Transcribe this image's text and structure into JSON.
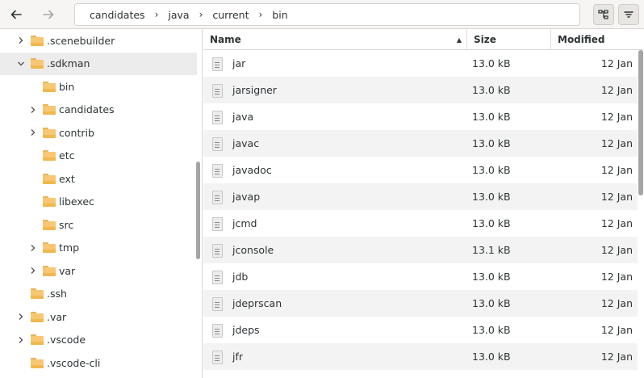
{
  "toolbar": {
    "back_icon": "back-arrow-icon",
    "forward_icon": "forward-arrow-icon",
    "breadcrumb": [
      "candidates",
      "java",
      "current",
      "bin"
    ]
  },
  "sidebar": {
    "items": [
      {
        "label": ".scenebuilder",
        "expandable": true,
        "expanded": false
      },
      {
        "label": ".sdkman",
        "expandable": true,
        "expanded": true,
        "selected": true
      },
      {
        "label": "bin",
        "expandable": false
      },
      {
        "label": "candidates",
        "expandable": true,
        "expanded": false
      },
      {
        "label": "contrib",
        "expandable": true,
        "expanded": false
      },
      {
        "label": "etc",
        "expandable": false
      },
      {
        "label": "ext",
        "expandable": false
      },
      {
        "label": "libexec",
        "expandable": false
      },
      {
        "label": "src",
        "expandable": false
      },
      {
        "label": "tmp",
        "expandable": true,
        "expanded": false
      },
      {
        "label": "var",
        "expandable": true,
        "expanded": false
      },
      {
        "label": ".ssh",
        "expandable": false
      },
      {
        "label": ".var",
        "expandable": true,
        "expanded": false
      },
      {
        "label": ".vscode",
        "expandable": true,
        "expanded": false
      },
      {
        "label": ".vscode-cli",
        "expandable": false
      }
    ]
  },
  "list": {
    "columns": {
      "name": "Name",
      "size": "Size",
      "modified": "Modified"
    },
    "rows": [
      {
        "name": "jar",
        "size": "13.0 kB",
        "modified": "12 Jan"
      },
      {
        "name": "jarsigner",
        "size": "13.0 kB",
        "modified": "12 Jan"
      },
      {
        "name": "java",
        "size": "13.0 kB",
        "modified": "12 Jan"
      },
      {
        "name": "javac",
        "size": "13.0 kB",
        "modified": "12 Jan"
      },
      {
        "name": "javadoc",
        "size": "13.0 kB",
        "modified": "12 Jan"
      },
      {
        "name": "javap",
        "size": "13.0 kB",
        "modified": "12 Jan"
      },
      {
        "name": "jcmd",
        "size": "13.0 kB",
        "modified": "12 Jan"
      },
      {
        "name": "jconsole",
        "size": "13.1 kB",
        "modified": "12 Jan"
      },
      {
        "name": "jdb",
        "size": "13.0 kB",
        "modified": "12 Jan"
      },
      {
        "name": "jdeprscan",
        "size": "13.0 kB",
        "modified": "12 Jan"
      },
      {
        "name": "jdeps",
        "size": "13.0 kB",
        "modified": "12 Jan"
      },
      {
        "name": "jfr",
        "size": "13.0 kB",
        "modified": "12 Jan"
      }
    ]
  }
}
